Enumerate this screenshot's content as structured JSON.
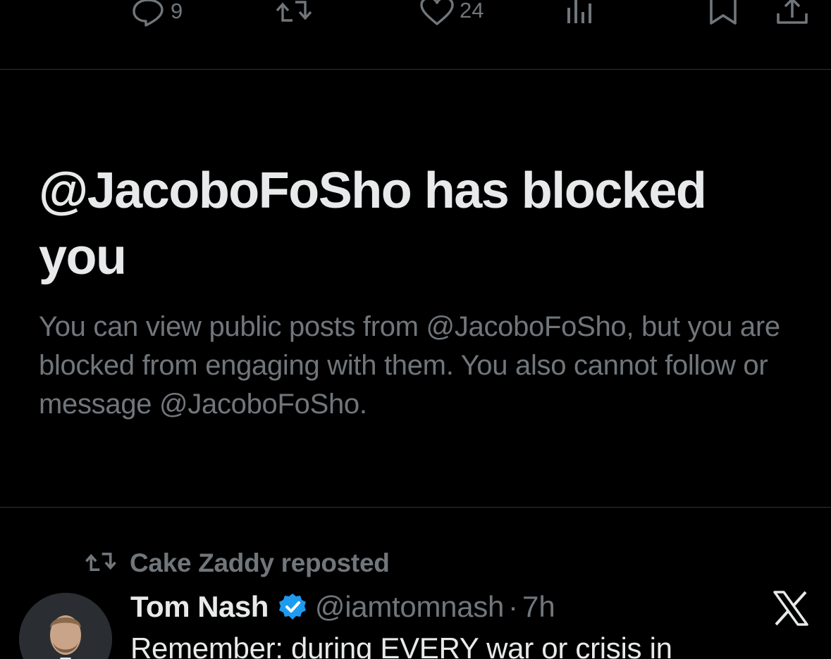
{
  "action_bar": {
    "reply_icon": "reply-bubble-icon",
    "reply_count": "9",
    "repost_icon": "repost-icon",
    "like_icon": "heart-icon",
    "like_count": "24",
    "views_icon": "views-chart-icon",
    "bookmark_icon": "bookmark-icon",
    "share_icon": "share-icon"
  },
  "blocked_notice": {
    "title": "@JacoboFoSho has blocked you",
    "description": "You can view public posts from @JacoboFoSho, but you are blocked from engaging with them. You also cannot follow or message @JacoboFoSho."
  },
  "repost_banner": {
    "icon": "repost-icon",
    "label": "Cake Zaddy reposted"
  },
  "tweet": {
    "author_name": "Tom Nash",
    "verified_icon": "verified-badge-icon",
    "handle": "@iamtomnash",
    "separator": "·",
    "time": "7h",
    "text": "Remember: during EVERY war or crisis in",
    "logo": "x-logo-icon"
  },
  "colors": {
    "background": "#000000",
    "primary_text": "#e7e9ea",
    "secondary_text": "#71767b",
    "divider": "#2f3336",
    "verified": "#1d9bf0"
  }
}
